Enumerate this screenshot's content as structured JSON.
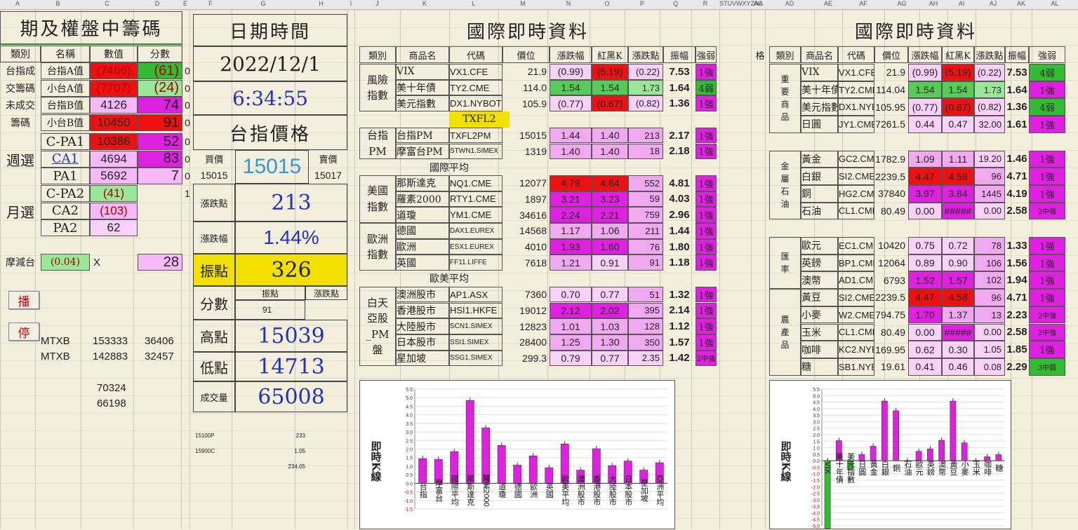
{
  "colheaders": [
    "A",
    "B",
    "C",
    "D",
    "E",
    "F",
    "G",
    "H",
    "I",
    "J",
    "K",
    "L",
    "M",
    "N",
    "O",
    "P",
    "Q",
    "R",
    "STUVWXYZAA",
    "AC",
    "AD",
    "AE",
    "AF",
    "AG",
    "AH",
    "AI",
    "AJ",
    "AK",
    "AL"
  ],
  "left": {
    "title": "期及權盤中籌碼",
    "headers": [
      "類別",
      "名稱",
      "數值",
      "分數"
    ],
    "rows": [
      {
        "cat": "台指成",
        "name": "台指A值",
        "val": "(7466)",
        "score": "(61)",
        "e": "0"
      },
      {
        "cat": "交籌碼",
        "name": "小台A值",
        "val": "(7707)",
        "score": "(24)",
        "e": "0"
      },
      {
        "cat": "未成交",
        "name": "台指B值",
        "val": "4126",
        "score": "74",
        "e": "0"
      },
      {
        "cat": "籌碼",
        "name": "小台B值",
        "val": "10450",
        "score": "91",
        "e": "0"
      }
    ],
    "weekly_label": "週選",
    "weekly": [
      {
        "name": "C-PA1",
        "val": "10386",
        "score": "52",
        "e": "0"
      },
      {
        "name": "CA1",
        "val": "4694",
        "score": "83",
        "e": "0"
      },
      {
        "name": "PA1",
        "val": "5692",
        "score": "7",
        "e": "0"
      }
    ],
    "monthly_label": "月選",
    "monthly": [
      {
        "name": "C-PA2",
        "val": "(41)",
        "e": "1"
      },
      {
        "name": "CA2",
        "val": "(103)"
      },
      {
        "name": "PA2",
        "val": "62"
      }
    ],
    "mtw_label": "摩減台",
    "mtw_val": "(0.04)",
    "mtw_x": "X",
    "mtw_score": "28",
    "btn_play": "播",
    "btn_stop": "停",
    "mtxb": [
      {
        "name": "MTXB",
        "a": "153333",
        "b": "36406"
      },
      {
        "name": "MTXB",
        "a": "142883",
        "b": "32457"
      }
    ],
    "extra": [
      "70324",
      "66198"
    ]
  },
  "mid": {
    "date_title": "日期時間",
    "date": "2022/12/1",
    "time": "6:34:55",
    "price_title": "台指價格",
    "buy_label": "買價",
    "sell_label": "賣價",
    "buy": "15015",
    "last": "15015",
    "sell": "15017",
    "chg_pts_label": "漲跌點",
    "chg_pts": "213",
    "chg_pct_label": "漲跌幅",
    "chg_pct": "1.44%",
    "amp_label": "振點",
    "amp": "326",
    "score_label": "分數",
    "score_sub1": "振點",
    "score_sub2": "漲跌點",
    "score_val": "91",
    "high_label": "高點",
    "high": "15039",
    "low_label": "低點",
    "low": "14713",
    "vol_label": "成交量",
    "vol": "65008",
    "notes": [
      {
        "k": "15100P",
        "v": "233"
      },
      {
        "k": "15900C",
        "v": "1.05"
      },
      {
        "k": "",
        "v": "234.05"
      }
    ]
  },
  "intl1": {
    "title": "國際即時資料",
    "headers": [
      "類別",
      "商品名",
      "代碼",
      "價位",
      "漲跌幅",
      "紅黑K",
      "漲跌點",
      "振幅",
      "強弱"
    ],
    "txfl2": "TXFL2",
    "avg_intl": "國際平均",
    "avg_euus": "歐美平均",
    "groups": [
      {
        "cat": "風險\n指數",
        "rows": [
          [
            "VIX",
            "VX1.CFE",
            "21.9",
            "(0.99)",
            "(5.19)",
            "(0.22)",
            "7.53",
            "1強"
          ],
          [
            "美十年債",
            "TY2.CME",
            "114.0",
            "1.54",
            "1.54",
            "1.73",
            "1.64",
            "4弱"
          ],
          [
            "美元指數",
            "DX1.NYBOT",
            "105.9",
            "(0.77)",
            "(0.67)",
            "(0.82)",
            "1.36",
            "1強"
          ]
        ]
      },
      {
        "cat": "台指\nPM",
        "rows": [
          [
            "台指PM",
            "TXFL2PM",
            "15015",
            "1.44",
            "1.40",
            "213",
            "2.17",
            "1強"
          ],
          [
            "摩富台PM",
            "STWN1.SIMEX",
            "1319",
            "1.40",
            "1.40",
            "18",
            "2.18",
            "1強"
          ]
        ]
      },
      {
        "cat": "美國\n指數",
        "rows": [
          [
            "那斯達克",
            "NQ1.CME",
            "12077",
            "4.79",
            "4.84",
            "552",
            "4.81",
            "1強"
          ],
          [
            "羅素2000",
            "RTY1.CME",
            "1897",
            "3.21",
            "3.23",
            "59",
            "4.03",
            "1強"
          ],
          [
            "道瓊",
            "YM1.CME",
            "34616",
            "2.24",
            "2.21",
            "759",
            "2.96",
            "1強"
          ]
        ]
      },
      {
        "cat": "歐洲\n指數",
        "rows": [
          [
            "德國",
            "DAX1.EUREX",
            "14568",
            "1.17",
            "1.06",
            "211",
            "1.44",
            "1強"
          ],
          [
            "歐洲",
            "ESX1.EUREX",
            "4010",
            "1.93",
            "1.60",
            "76",
            "1.80",
            "1強"
          ],
          [
            "英國",
            "FF11.LIFFE",
            "7618",
            "1.21",
            "0.91",
            "91",
            "1.18",
            "1強"
          ]
        ]
      },
      {
        "cat": "白天\n亞股\n_PM\n盤",
        "rows": [
          [
            "澳洲股市",
            "AP1.ASX",
            "7360",
            "0.70",
            "0.77",
            "51",
            "1.32",
            "1強"
          ],
          [
            "香港股市",
            "HSI1.HKFE",
            "19012",
            "2.12",
            "2.02",
            "395",
            "2.14",
            "1強"
          ],
          [
            "大陸股市",
            "SCN1.SIMEX",
            "12823",
            "1.01",
            "1.03",
            "128",
            "1.12",
            "1強"
          ],
          [
            "日本股市",
            "SSI1.SIMEX",
            "28400",
            "1.25",
            "1.30",
            "350",
            "1.57",
            "1強"
          ],
          [
            "星加坡",
            "SSG1.SIMEX",
            "299.3",
            "0.79",
            "0.77",
            "2.35",
            "1.42",
            "2中強"
          ]
        ]
      }
    ]
  },
  "intl2": {
    "title": "國際即時資料",
    "headers": [
      "類別",
      "商品名",
      "代碼",
      "價位",
      "漲跌幅",
      "紅黑K",
      "漲跌點",
      "振幅",
      "強弱"
    ],
    "extra_header": "格",
    "groups": [
      {
        "cat": "重\n要\n商\n品",
        "rows": [
          [
            "VIX",
            "VX1.CFE",
            "21.9",
            "(0.99)",
            "(5.19)",
            "(0.22)",
            "7.53",
            "4弱"
          ],
          [
            "美十年債",
            "TY2.CME",
            "114.04",
            "1.54",
            "1.54",
            "1.73",
            "1.64",
            "1強"
          ],
          [
            "美元指數",
            "DX1.NYBOT",
            "105.95",
            "(0.77)",
            "(0.67)",
            "(0.82)",
            "1.36",
            "4弱"
          ],
          [
            "日圓",
            "JY1.CME",
            "7261.5",
            "0.44",
            "0.47",
            "32.00",
            "1.61",
            "1強"
          ]
        ]
      },
      {
        "cat": "金\n屬\n石\n油",
        "rows": [
          [
            "黃金",
            "GC2.CME",
            "1782.9",
            "1.09",
            "1.11",
            "19.20",
            "1.46",
            "1強"
          ],
          [
            "白銀",
            "SI2.CME",
            "2239.5",
            "4.47",
            "4.58",
            "96",
            "4.71",
            "1強"
          ],
          [
            "銅",
            "HG2.CME",
            "37840",
            "3.97",
            "3.84",
            "1445",
            "4.19",
            "1強"
          ],
          [
            "石油",
            "CL1.CME",
            "80.49",
            "0.00",
            "#####",
            "0.00",
            "2.58",
            "2中強"
          ]
        ]
      },
      {
        "cat": "匯\n率",
        "rows": [
          [
            "歐元",
            "EC1.CME",
            "10420",
            "0.75",
            "0.72",
            "78",
            "1.33",
            "1強"
          ],
          [
            "英鎊",
            "BP1.CME",
            "12064",
            "0.89",
            "0.90",
            "106",
            "1.56",
            "1強"
          ],
          [
            "澳幣",
            "AD1.CME",
            "6793",
            "1.52",
            "1.57",
            "102",
            "1.94",
            "1強"
          ]
        ]
      },
      {
        "cat": "農\n產\n品",
        "rows": [
          [
            "黃豆",
            "SI2.CME",
            "2239.5",
            "4.47",
            "4.58",
            "96",
            "4.71",
            "1強"
          ],
          [
            "小麥",
            "W2.CME",
            "794.75",
            "1.70",
            "1.37",
            "13",
            "2.23",
            "2中強"
          ],
          [
            "玉米",
            "CL1.CME",
            "80.49",
            "0.00",
            "#####",
            "0.00",
            "2.58",
            "2中強"
          ],
          [
            "咖啡",
            "KC2.NYBOT",
            "169.95",
            "0.62",
            "0.30",
            "1.05",
            "1.85",
            "1強"
          ],
          [
            "糖",
            "SB1.NYBOT",
            "19.61",
            "0.41",
            "0.46",
            "0.08",
            "2.29",
            "3中弱"
          ]
        ]
      }
    ]
  },
  "chart_data": [
    {
      "type": "bar",
      "title": "即時K線",
      "ylim": [
        -1.5,
        5.5
      ],
      "yticks": [
        "5.5",
        "5.0",
        "4.5",
        "4.0",
        "3.5",
        "3.0",
        "2.5",
        "2.0",
        "1.5",
        "1.0",
        "0.5",
        "0.0",
        "-0.5",
        "-1.0",
        "-1.5"
      ],
      "categories": [
        "台指",
        "摩富台",
        "國際平均",
        "那斯達克",
        "羅素2000",
        "道瓊",
        "德國",
        "歐洲",
        "英國",
        "歐美平均",
        "澳洲股市",
        "香港股市",
        "大陸股市",
        "日本股市",
        "星加坡",
        "亞洲平均"
      ],
      "values": [
        1.44,
        1.4,
        1.85,
        4.84,
        3.23,
        2.21,
        1.06,
        1.6,
        0.91,
        2.3,
        0.77,
        2.02,
        1.03,
        1.3,
        0.77,
        1.2
      ]
    },
    {
      "type": "bar",
      "title": "即時K線",
      "ylim": [
        -5.0,
        5.5
      ],
      "yticks": [
        "5.5",
        "5.0",
        "4.5",
        "4.0",
        "3.5",
        "3.0",
        "2.5",
        "2.0",
        "1.5",
        "1.0",
        "0.5",
        "0.0",
        "-0.5",
        "-1.0",
        "-1.5",
        "-2.0",
        "-2.5",
        "-3.0",
        "-3.5",
        "-4.0",
        "-4.5",
        "-5.0"
      ],
      "categories": [
        "VIX",
        "美十年債",
        "美元指數",
        "日圓",
        "黃金",
        "白銀",
        "銅",
        "石油",
        "歐元",
        "英鎊",
        "澳幣",
        "黃豆",
        "小麥",
        "玉米",
        "咖啡",
        "糖"
      ],
      "values": [
        -5.19,
        1.54,
        -0.67,
        0.47,
        1.11,
        4.58,
        3.84,
        0.0,
        0.72,
        0.9,
        1.57,
        4.58,
        1.37,
        0.0,
        0.3,
        0.46
      ],
      "colors": [
        "#33bb33",
        "#e020e0",
        "#33bb33",
        "#e020e0",
        "#e020e0",
        "#e020e0",
        "#e020e0",
        "#e020e0",
        "#e020e0",
        "#e020e0",
        "#e020e0",
        "#e020e0",
        "#e020e0",
        "#e020e0",
        "#e020e0",
        "#e020e0"
      ]
    }
  ]
}
